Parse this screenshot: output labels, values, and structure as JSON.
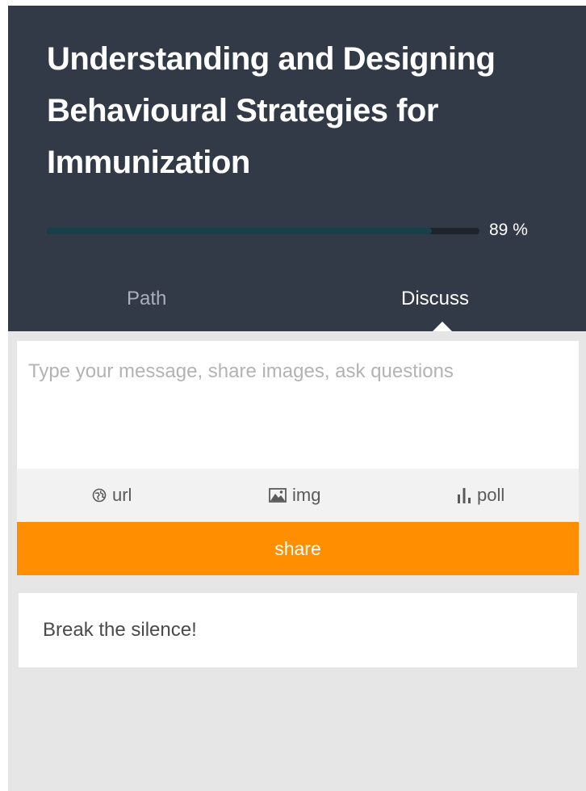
{
  "course": {
    "title": "Understanding and Designing Behavioural Strategies for Immunization",
    "progress_label": "89 %",
    "progress_fraction": 0.89
  },
  "tabs": [
    {
      "label": "Path",
      "active": false
    },
    {
      "label": "Discuss",
      "active": true
    }
  ],
  "composer": {
    "placeholder": "Type your message, share images, ask questions",
    "value": ""
  },
  "toolbar": {
    "url_label": "url",
    "url_icon": "globe-icon",
    "img_label": "img",
    "img_icon": "image-icon",
    "poll_label": "poll",
    "poll_icon": "bar-chart-icon"
  },
  "share_label": "share",
  "feed": {
    "empty_message": "Break the silence!"
  },
  "colors": {
    "header_bg": "#333a47",
    "accent": "#ff8f00",
    "progress_fill": "#17404a",
    "page_bg": "#e6e6e6"
  }
}
